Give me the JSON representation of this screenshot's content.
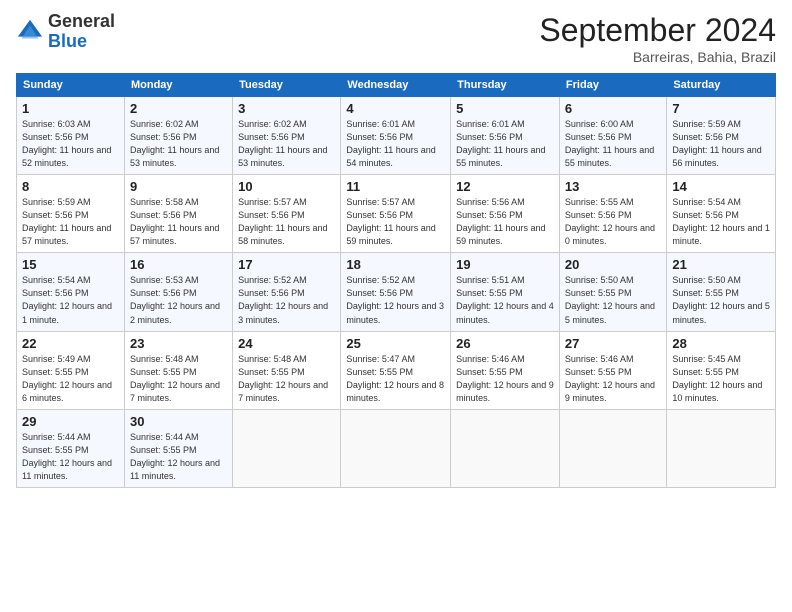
{
  "header": {
    "logo_line1": "General",
    "logo_line2": "Blue",
    "month": "September 2024",
    "location": "Barreiras, Bahia, Brazil"
  },
  "weekdays": [
    "Sunday",
    "Monday",
    "Tuesday",
    "Wednesday",
    "Thursday",
    "Friday",
    "Saturday"
  ],
  "weeks": [
    [
      {
        "day": "1",
        "info": "Sunrise: 6:03 AM\nSunset: 5:56 PM\nDaylight: 11 hours\nand 52 minutes."
      },
      {
        "day": "2",
        "info": "Sunrise: 6:02 AM\nSunset: 5:56 PM\nDaylight: 11 hours\nand 53 minutes."
      },
      {
        "day": "3",
        "info": "Sunrise: 6:02 AM\nSunset: 5:56 PM\nDaylight: 11 hours\nand 53 minutes."
      },
      {
        "day": "4",
        "info": "Sunrise: 6:01 AM\nSunset: 5:56 PM\nDaylight: 11 hours\nand 54 minutes."
      },
      {
        "day": "5",
        "info": "Sunrise: 6:01 AM\nSunset: 5:56 PM\nDaylight: 11 hours\nand 55 minutes."
      },
      {
        "day": "6",
        "info": "Sunrise: 6:00 AM\nSunset: 5:56 PM\nDaylight: 11 hours\nand 55 minutes."
      },
      {
        "day": "7",
        "info": "Sunrise: 5:59 AM\nSunset: 5:56 PM\nDaylight: 11 hours\nand 56 minutes."
      }
    ],
    [
      {
        "day": "8",
        "info": "Sunrise: 5:59 AM\nSunset: 5:56 PM\nDaylight: 11 hours\nand 57 minutes."
      },
      {
        "day": "9",
        "info": "Sunrise: 5:58 AM\nSunset: 5:56 PM\nDaylight: 11 hours\nand 57 minutes."
      },
      {
        "day": "10",
        "info": "Sunrise: 5:57 AM\nSunset: 5:56 PM\nDaylight: 11 hours\nand 58 minutes."
      },
      {
        "day": "11",
        "info": "Sunrise: 5:57 AM\nSunset: 5:56 PM\nDaylight: 11 hours\nand 59 minutes."
      },
      {
        "day": "12",
        "info": "Sunrise: 5:56 AM\nSunset: 5:56 PM\nDaylight: 11 hours\nand 59 minutes."
      },
      {
        "day": "13",
        "info": "Sunrise: 5:55 AM\nSunset: 5:56 PM\nDaylight: 12 hours\nand 0 minutes."
      },
      {
        "day": "14",
        "info": "Sunrise: 5:54 AM\nSunset: 5:56 PM\nDaylight: 12 hours\nand 1 minute."
      }
    ],
    [
      {
        "day": "15",
        "info": "Sunrise: 5:54 AM\nSunset: 5:56 PM\nDaylight: 12 hours\nand 1 minute."
      },
      {
        "day": "16",
        "info": "Sunrise: 5:53 AM\nSunset: 5:56 PM\nDaylight: 12 hours\nand 2 minutes."
      },
      {
        "day": "17",
        "info": "Sunrise: 5:52 AM\nSunset: 5:56 PM\nDaylight: 12 hours\nand 3 minutes."
      },
      {
        "day": "18",
        "info": "Sunrise: 5:52 AM\nSunset: 5:56 PM\nDaylight: 12 hours\nand 3 minutes."
      },
      {
        "day": "19",
        "info": "Sunrise: 5:51 AM\nSunset: 5:55 PM\nDaylight: 12 hours\nand 4 minutes."
      },
      {
        "day": "20",
        "info": "Sunrise: 5:50 AM\nSunset: 5:55 PM\nDaylight: 12 hours\nand 5 minutes."
      },
      {
        "day": "21",
        "info": "Sunrise: 5:50 AM\nSunset: 5:55 PM\nDaylight: 12 hours\nand 5 minutes."
      }
    ],
    [
      {
        "day": "22",
        "info": "Sunrise: 5:49 AM\nSunset: 5:55 PM\nDaylight: 12 hours\nand 6 minutes."
      },
      {
        "day": "23",
        "info": "Sunrise: 5:48 AM\nSunset: 5:55 PM\nDaylight: 12 hours\nand 7 minutes."
      },
      {
        "day": "24",
        "info": "Sunrise: 5:48 AM\nSunset: 5:55 PM\nDaylight: 12 hours\nand 7 minutes."
      },
      {
        "day": "25",
        "info": "Sunrise: 5:47 AM\nSunset: 5:55 PM\nDaylight: 12 hours\nand 8 minutes."
      },
      {
        "day": "26",
        "info": "Sunrise: 5:46 AM\nSunset: 5:55 PM\nDaylight: 12 hours\nand 9 minutes."
      },
      {
        "day": "27",
        "info": "Sunrise: 5:46 AM\nSunset: 5:55 PM\nDaylight: 12 hours\nand 9 minutes."
      },
      {
        "day": "28",
        "info": "Sunrise: 5:45 AM\nSunset: 5:55 PM\nDaylight: 12 hours\nand 10 minutes."
      }
    ],
    [
      {
        "day": "29",
        "info": "Sunrise: 5:44 AM\nSunset: 5:55 PM\nDaylight: 12 hours\nand 11 minutes."
      },
      {
        "day": "30",
        "info": "Sunrise: 5:44 AM\nSunset: 5:55 PM\nDaylight: 12 hours\nand 11 minutes."
      },
      {
        "day": "",
        "info": ""
      },
      {
        "day": "",
        "info": ""
      },
      {
        "day": "",
        "info": ""
      },
      {
        "day": "",
        "info": ""
      },
      {
        "day": "",
        "info": ""
      }
    ]
  ]
}
